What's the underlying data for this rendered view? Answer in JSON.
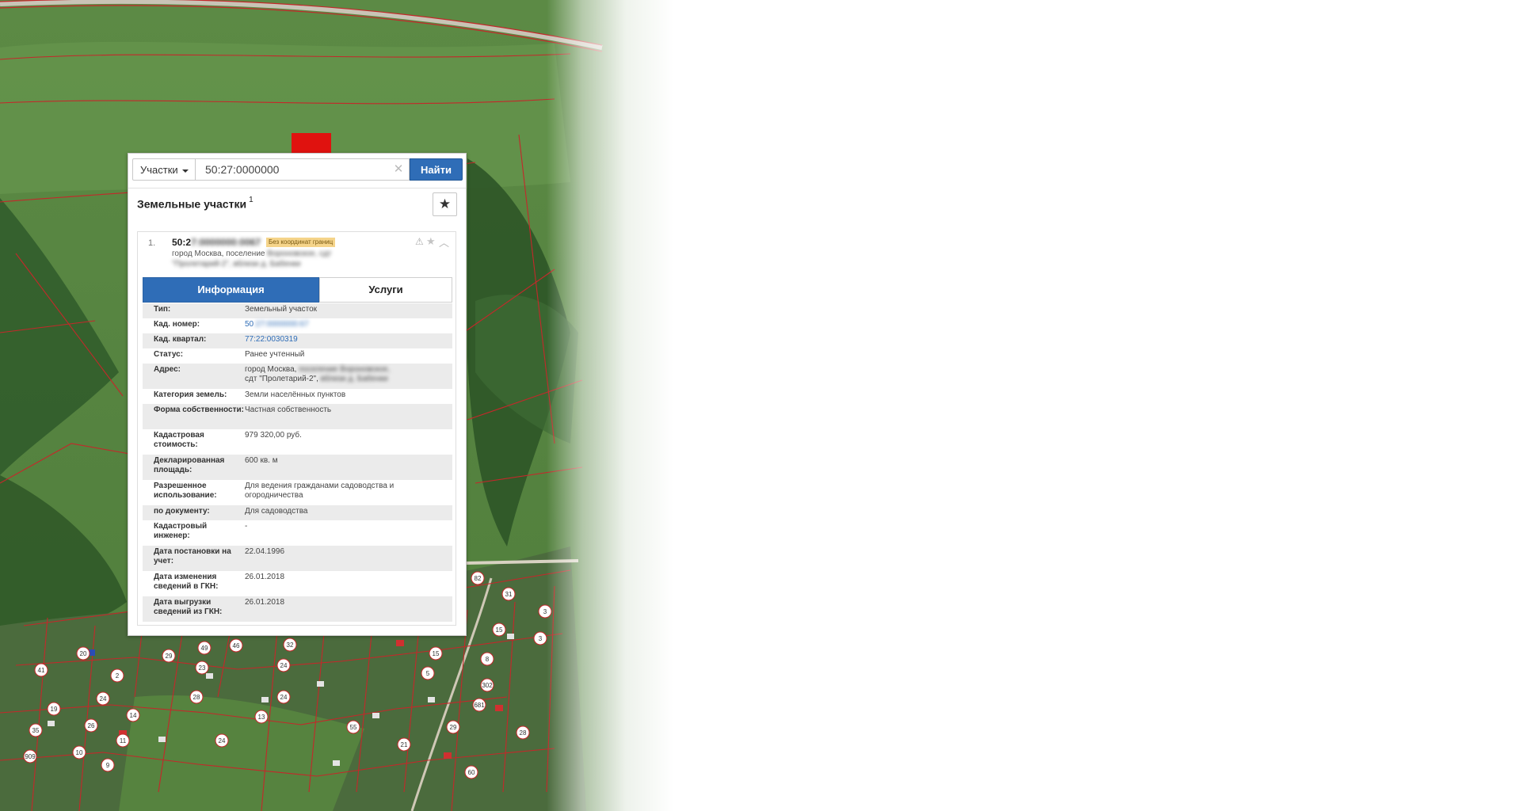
{
  "search": {
    "type_label": "Участки",
    "query_value": "50:27:0000000",
    "find_label": "Найти"
  },
  "results": {
    "title": "Земельные участки",
    "count": "1",
    "item": {
      "index": "1.",
      "number_prefix": "50:2",
      "number_blurred": "7:0000000:0067",
      "badge": "Без координат границ",
      "address_visible": "город Москва, поселение",
      "address_blurred": "Вороновское, сдт \"Пролетарий-2\", вблизи д. Бабенки"
    },
    "tabs": {
      "info": "Информация",
      "services": "Услуги"
    },
    "info": {
      "type": {
        "label": "Тип:",
        "value": "Земельный участок"
      },
      "cad_number": {
        "label": "Кад. номер:",
        "value_prefix": "50",
        "value_blurred": ":27:0000000:67"
      },
      "cad_quarter": {
        "label": "Кад. квартал:",
        "value": "77:22:0030319"
      },
      "status": {
        "label": "Статус:",
        "value": "Ранее учтенный"
      },
      "address": {
        "label": "Адрес:",
        "value_prefix": "город Москва,",
        "value_blur1": "поселение Вороновское,",
        "value_line2a": "сдт \"Пролетарий-2\",",
        "value_blur2": "вблизи д. Бабенки"
      },
      "land_category": {
        "label": "Категория земель:",
        "value": "Земли населённых пунктов"
      },
      "ownership": {
        "label": "Форма собственности:",
        "value": "Частная собственность"
      },
      "cad_cost": {
        "label": "Кадастровая стоимость:",
        "value": "979 320,00 руб."
      },
      "declared_area": {
        "label": "Декларированная площадь:",
        "value": "600 кв. м"
      },
      "permitted_use": {
        "label": "Разрешенное использование:",
        "value": "Для ведения гражданами садоводства и огородничества"
      },
      "by_document": {
        "label": "по документу:",
        "value": "Для садоводства"
      },
      "engineer": {
        "label": "Кадастровый инженер:",
        "value": "-"
      },
      "registered_date": {
        "label": "Дата постановки на учет:",
        "value": "22.04.1996"
      },
      "changed_date": {
        "label": "Дата изменения сведений в ГКН:",
        "value": "26.01.2018"
      },
      "export_date": {
        "label": "Дата выгрузки сведений из ГКН:",
        "value": "26.01.2018"
      }
    }
  },
  "map": {
    "plot_labels": [
      "82",
      "31",
      "3",
      "15",
      "3",
      "20",
      "29",
      "49",
      "46",
      "32",
      "15",
      "8",
      "41",
      "23",
      "2",
      "24",
      "24",
      "19",
      "14",
      "26",
      "11",
      "35",
      "10",
      "9",
      "24",
      "28",
      "13",
      "55",
      "5",
      "302",
      "681",
      "29",
      "28",
      "60",
      "909",
      "21",
      "24"
    ]
  },
  "colors": {
    "accent": "#2f6db7",
    "arrow": "#e0120f",
    "boundary": "#c4282a"
  }
}
